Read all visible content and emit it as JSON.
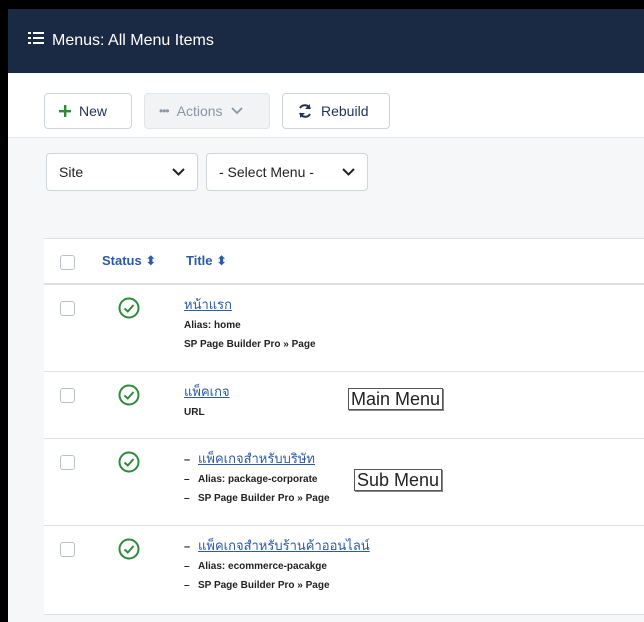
{
  "header": {
    "title": "Menus: All Menu Items",
    "icon": "list-icon"
  },
  "toolbar": {
    "new_label": "New",
    "actions_label": "Actions",
    "rebuild_label": "Rebuild"
  },
  "filters": {
    "site_value": "Site",
    "menu_value": "- Select Menu -"
  },
  "table": {
    "headers": {
      "status": "Status ⬍",
      "title": "Title ⬍"
    },
    "rows": [
      {
        "level": 1,
        "title": "หน้าแรก",
        "line1": "Alias: home",
        "line2": "SP Page Builder Pro » Page"
      },
      {
        "level": 1,
        "title": "แพ็คเกจ",
        "line1": "URL",
        "line2": ""
      },
      {
        "level": 2,
        "title": "แพ็คเกจสำหรับบริษัท",
        "line1": "Alias: package-corporate",
        "line2": "SP Page Builder Pro » Page"
      },
      {
        "level": 2,
        "title": "แพ็คเกจสำหรับร้านค้าออนไลน์",
        "line1": "Alias: ecommerce-pacakge",
        "line2": "SP Page Builder Pro » Page"
      }
    ]
  },
  "annotations": {
    "main": "Main Menu",
    "sub": "Sub Menu"
  },
  "colors": {
    "header_bg": "#1a2a44",
    "link": "#2a5aa8",
    "published": "#2e8b3a"
  }
}
